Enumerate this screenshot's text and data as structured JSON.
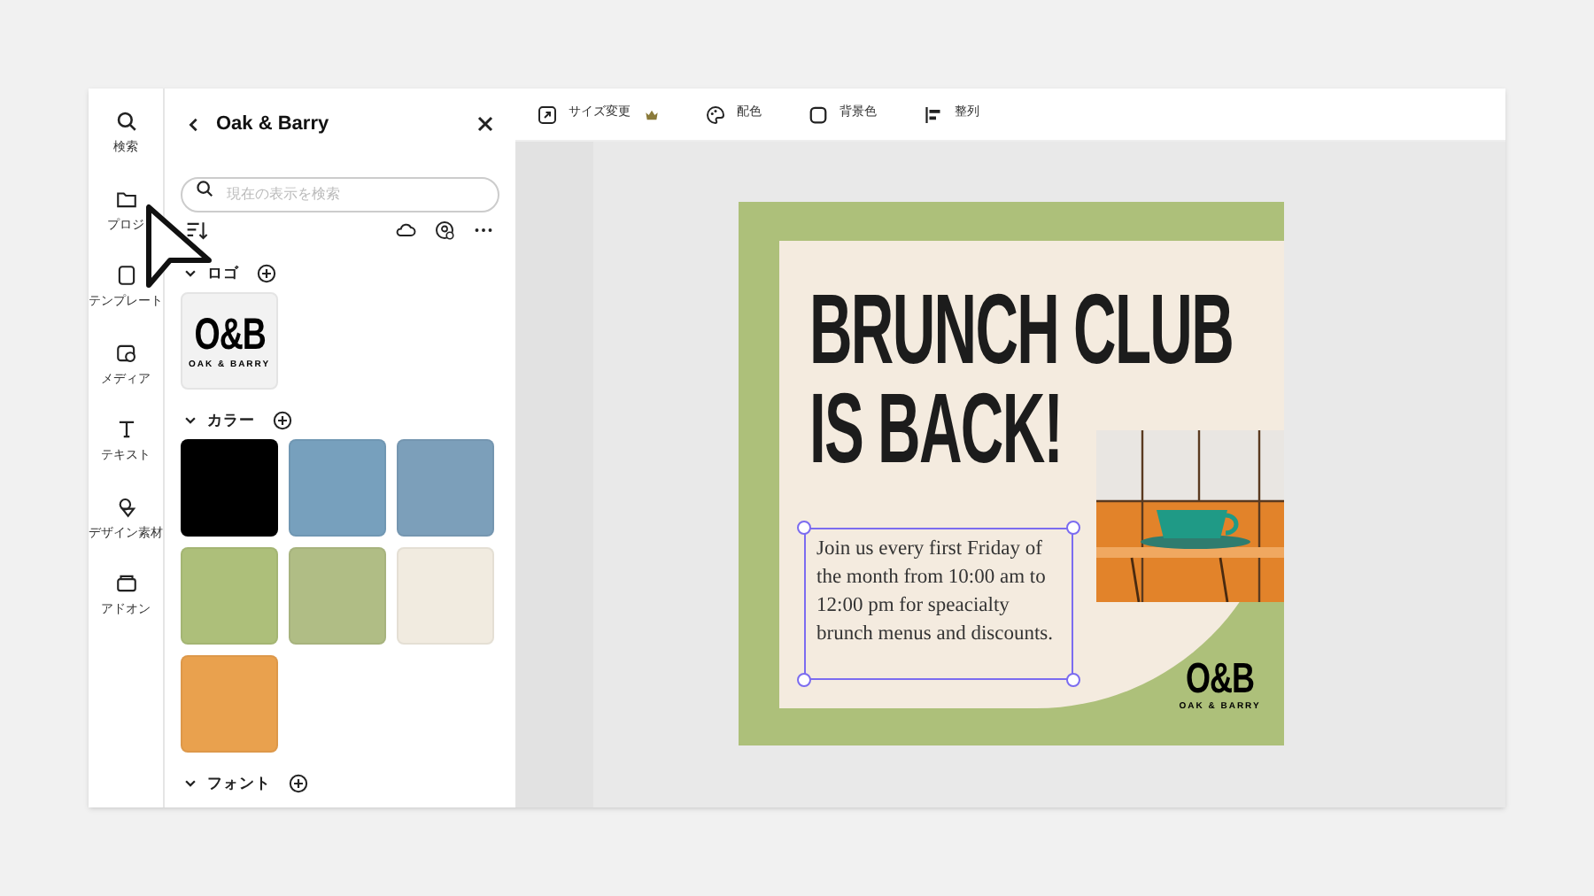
{
  "nav": [
    {
      "label": "検索",
      "kind": "search"
    },
    {
      "label": "プロジ",
      "kind": "folder"
    },
    {
      "label": "テンプレート",
      "kind": "template"
    },
    {
      "label": "メディア",
      "kind": "media"
    },
    {
      "label": "テキスト",
      "kind": "text"
    },
    {
      "label": "デザイン素材",
      "kind": "shapes"
    },
    {
      "label": "アドオン",
      "kind": "addon"
    }
  ],
  "panel": {
    "title": "Oak & Barry",
    "search": {
      "placeholder": "現在の表示を検索"
    },
    "sections": [
      {
        "kind": "logos",
        "title": "ロゴ",
        "logo": {
          "mark": "O&B",
          "sub": "OAK & BARRY"
        }
      },
      {
        "kind": "colors",
        "title": "カラー",
        "colors": [
          {
            "color": "#000000"
          },
          {
            "color": "#77a0bd"
          },
          {
            "color": "#7c9fba"
          },
          {
            "color": "#adbf7a"
          },
          {
            "color": "#b0bd85"
          },
          {
            "color": "#f1ebe0"
          },
          {
            "color": "#e9a14e"
          }
        ]
      },
      {
        "kind": "fonts",
        "title": "フォント"
      }
    ]
  },
  "toolbar": [
    {
      "label": "サイズ変更",
      "kind": "resize",
      "premium": true
    },
    {
      "label": "配色",
      "kind": "palette",
      "premium": false
    },
    {
      "label": "背景色",
      "kind": "background",
      "premium": false
    },
    {
      "label": "整列",
      "kind": "align",
      "premium": false
    }
  ],
  "design": {
    "headline": [
      "BRUNCH CLUB",
      "IS BACK!"
    ],
    "body": "Join us every first Friday of the month from 10:00 am to 12:00 pm for speacialty brunch menus and discounts.",
    "body_selected": true,
    "photo": {
      "kind": "picture"
    },
    "logo": {
      "mark": "O&B",
      "sub": "OAK & BARRY"
    }
  }
}
